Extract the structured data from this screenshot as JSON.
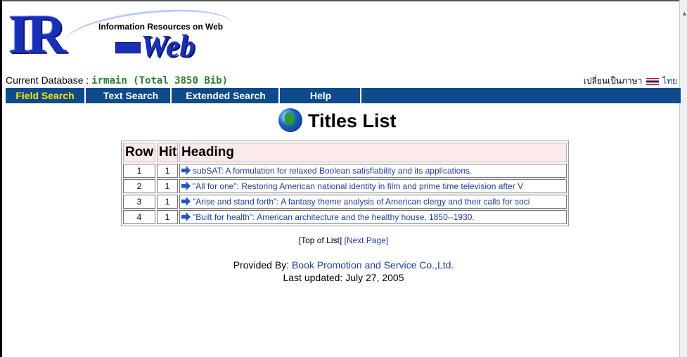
{
  "logo": {
    "main": "IR",
    "web": "Web",
    "subtitle": "Information Resources on Web"
  },
  "database": {
    "label": "Current Database : ",
    "name": "irmain (Total 3850 Bib)"
  },
  "language": {
    "switch_label": "เปลี่ยนเป็นภาษา",
    "thai_label": "ไทย"
  },
  "nav": {
    "field_search": "Field Search",
    "text_search": "Text Search",
    "extended_search": "Extended Search",
    "help": "Help"
  },
  "page_title": "Titles List",
  "table": {
    "headers": [
      "Row",
      "Hit",
      "Heading"
    ],
    "rows": [
      {
        "row": "1",
        "hit": "1",
        "heading": "subSAT: A formulation for relaxed Boolean satisfiability and its applications."
      },
      {
        "row": "2",
        "hit": "1",
        "heading": "\"All for one\": Restoring American national identity in film and prime time television after V"
      },
      {
        "row": "3",
        "hit": "1",
        "heading": "\"Arise and stand forth\": A fantasy theme analysis of American clergy and their calls for soci"
      },
      {
        "row": "4",
        "hit": "1",
        "heading": "\"Built for health\": American architecture and the healthy house, 1850--1930."
      }
    ]
  },
  "pager": {
    "top": "[Top of List]",
    "next": "[Next Page]"
  },
  "footer": {
    "provided_label": "Provided By: ",
    "provider": "Book Promotion and Service Co.,Ltd.",
    "updated": "Last updated: July 27, 2005"
  },
  "colors": {
    "nav_bg": "#0d4b8c",
    "active_tab": "#ffe600",
    "header_bg": "#fce9e9",
    "link": "#1f3f9e",
    "db_name": "#2e7d32"
  }
}
